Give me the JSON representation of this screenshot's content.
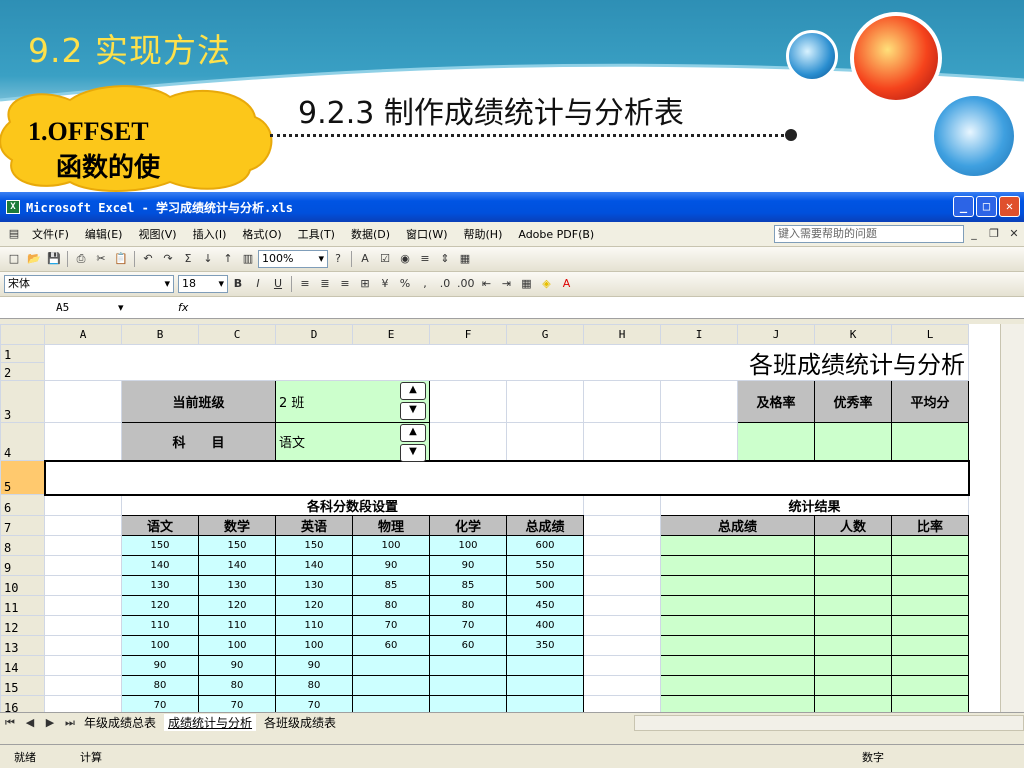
{
  "slide": {
    "section_title": "9.2 实现方法",
    "subtitle": "9.2.3 制作成绩统计与分析表",
    "cloud_line1": "1.OFFSET",
    "cloud_line2": "函数的使"
  },
  "excel": {
    "window_title": "Microsoft Excel - 学习成绩统计与分析.xls",
    "menus": [
      "文件(F)",
      "编辑(E)",
      "视图(V)",
      "插入(I)",
      "格式(O)",
      "工具(T)",
      "数据(D)",
      "窗口(W)",
      "帮助(H)",
      "Adobe PDF(B)"
    ],
    "help_placeholder": "键入需要帮助的问题",
    "zoom": "100%",
    "font_name": "宋体",
    "font_size": "18",
    "name_box": "A5",
    "fx": "fx",
    "columns": [
      "A",
      "B",
      "C",
      "D",
      "E",
      "F",
      "G",
      "H",
      "I",
      "J",
      "K",
      "L"
    ],
    "sheet_title": "各班成绩统计与分析",
    "current_class_label": "当前班级",
    "current_class_value": "2 班",
    "subject_label": "科　　目",
    "subject_value": "语文",
    "stats_headers": [
      "及格率",
      "优秀率",
      "平均分"
    ],
    "range_setting_title": "各科分数段设置",
    "range_headers": [
      "语文",
      "数学",
      "英语",
      "物理",
      "化学",
      "总成绩"
    ],
    "range_rows": [
      [
        "150",
        "150",
        "150",
        "100",
        "100",
        "600"
      ],
      [
        "140",
        "140",
        "140",
        "90",
        "90",
        "550"
      ],
      [
        "130",
        "130",
        "130",
        "85",
        "85",
        "500"
      ],
      [
        "120",
        "120",
        "120",
        "80",
        "80",
        "450"
      ],
      [
        "110",
        "110",
        "110",
        "70",
        "70",
        "400"
      ],
      [
        "100",
        "100",
        "100",
        "60",
        "60",
        "350"
      ],
      [
        "90",
        "90",
        "90",
        "",
        "",
        ""
      ],
      [
        "80",
        "80",
        "80",
        "",
        "",
        ""
      ],
      [
        "70",
        "70",
        "70",
        "",
        "",
        ""
      ]
    ],
    "result_title": "统计结果",
    "result_headers": [
      "总成绩",
      "人数",
      "比率"
    ],
    "row_numbers": [
      "1",
      "2",
      "3",
      "4",
      "5",
      "6",
      "7",
      "8",
      "9",
      "10",
      "11",
      "12",
      "13",
      "14",
      "15",
      "16"
    ],
    "sheet_tabs": [
      "年级成绩总表",
      "成绩统计与分析",
      "各班级成绩表"
    ],
    "status_ready": "就绪",
    "status_calc": "计算",
    "status_num": "数字"
  }
}
